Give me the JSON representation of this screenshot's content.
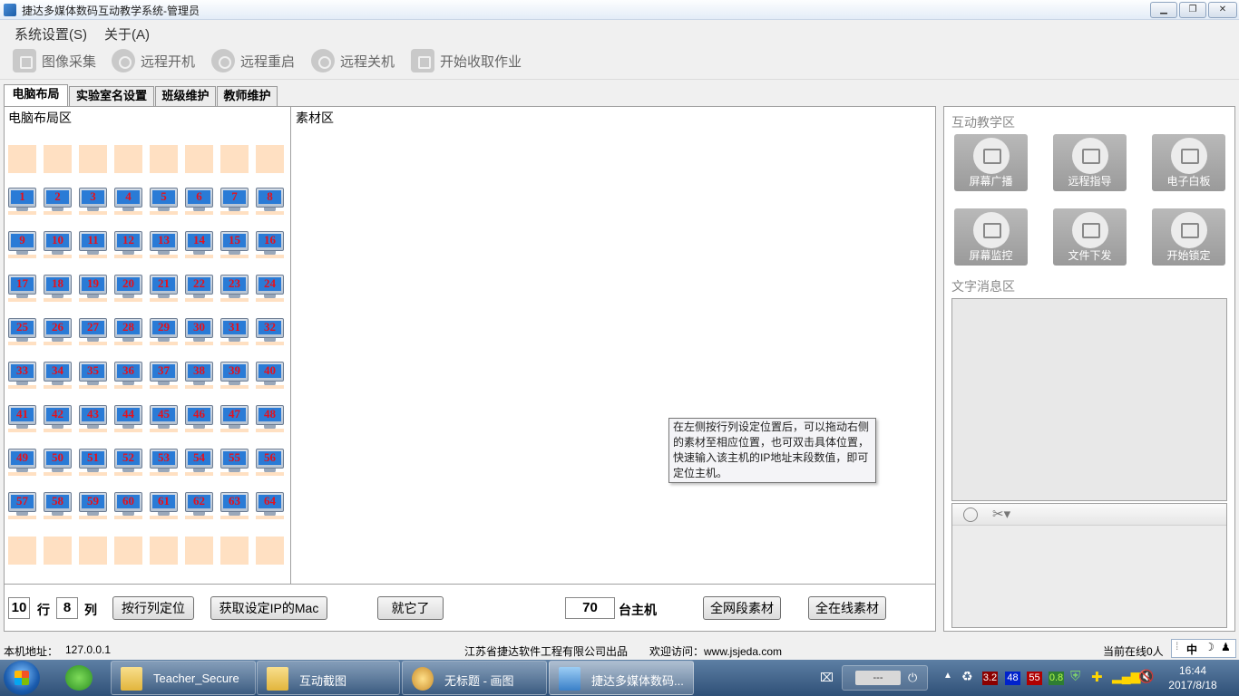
{
  "window": {
    "title": "捷达多媒体数码互动教学系统-管理员",
    "min": "▁",
    "max": "❐",
    "close": "✕"
  },
  "menu": [
    "系统设置(S)",
    "关于(A)"
  ],
  "toolbar": [
    "图像采集",
    "远程开机",
    "远程重启",
    "远程关机",
    "开始收取作业"
  ],
  "tabs": [
    "电脑布局",
    "实验室名设置",
    "班级维护",
    "教师维护"
  ],
  "layout_area": {
    "title": "电脑布局区",
    "rows": 10,
    "cols": 8,
    "pc_rows": [
      [
        1,
        2,
        3,
        4,
        5,
        6,
        7,
        8
      ],
      [
        9,
        10,
        11,
        12,
        13,
        14,
        15,
        16
      ],
      [
        17,
        18,
        19,
        20,
        21,
        22,
        23,
        24
      ],
      [
        25,
        26,
        27,
        28,
        29,
        30,
        31,
        32
      ],
      [
        33,
        34,
        35,
        36,
        37,
        38,
        39,
        40
      ],
      [
        41,
        42,
        43,
        44,
        45,
        46,
        47,
        48
      ],
      [
        49,
        50,
        51,
        52,
        53,
        54,
        55,
        56
      ],
      [
        57,
        58,
        59,
        60,
        61,
        62,
        63,
        64
      ]
    ]
  },
  "material_area": {
    "title": "素材区"
  },
  "tooltip": [
    "在左侧按行列设定位置后，可以拖动右侧",
    "的素材至相应位置，也可双击具体位置，",
    "快速输入该主机的IP地址末段数值，即可",
    "定位主机。"
  ],
  "controls": {
    "rows_value": "10",
    "rows_label": "行",
    "cols_value": "8",
    "cols_label": "列",
    "btn_position": "按行列定位",
    "btn_get_mac": "获取设定IP的Mac",
    "btn_done": "就它了",
    "hosts_value": "70",
    "hosts_label": "台主机",
    "btn_all_segment": "全网段素材",
    "btn_all_online": "全在线素材"
  },
  "interactive": {
    "title": "互动教学区",
    "buttons": [
      "屏幕广播",
      "远程指导",
      "电子白板",
      "屏幕监控",
      "文件下发",
      "开始锁定"
    ]
  },
  "message": {
    "title": "文字消息区"
  },
  "status": {
    "local_addr_label": "本机地址：",
    "local_addr": "127.0.0.1",
    "company": "江苏省捷达软件工程有限公司出品",
    "website": "欢迎访问：www.jsjeda.com",
    "online": "当前在线0人"
  },
  "ime": "中",
  "taskbar": {
    "tasks": [
      "Teacher_Secure",
      "互动截图",
      "无标题 - 画图",
      "捷达多媒体数码..."
    ],
    "tray_values": [
      "3.2",
      "48",
      "55",
      "0.8"
    ],
    "tray_colors": [
      "#8b0000",
      "#0022cc",
      "#b00000",
      "#2e7d32"
    ],
    "time": "16:44",
    "date": "2017/8/18",
    "input_dash": "---"
  },
  "colors": {
    "accent_red": "#e8101a",
    "cell_peach": "#ffe0c2",
    "screen_blue": "#2a7bd6"
  }
}
